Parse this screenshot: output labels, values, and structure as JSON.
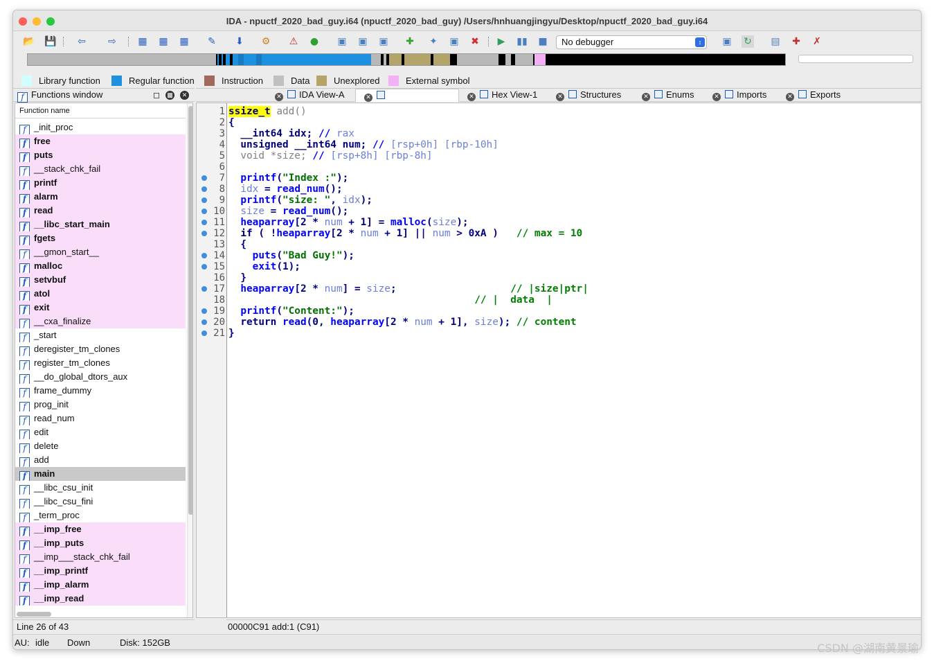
{
  "window": {
    "title": "IDA - npuctf_2020_bad_guy.i64 (npuctf_2020_bad_guy) /Users/hnhuangjingyu/Desktop/npuctf_2020_bad_guy.i64"
  },
  "toolbar": {
    "debugger_select": "No debugger"
  },
  "legend": [
    {
      "label": "Library function",
      "color": "#cfffff"
    },
    {
      "label": "Regular function",
      "color": "#1e90e0"
    },
    {
      "label": "Instruction",
      "color": "#a0695a"
    },
    {
      "label": "Data",
      "color": "#c0c0c0"
    },
    {
      "label": "Unexplored",
      "color": "#b5a46a"
    },
    {
      "label": "External symbol",
      "color": "#f4b0f4"
    }
  ],
  "functions_window": {
    "title": "Functions window",
    "column_header": "Function name",
    "items": [
      {
        "name": "_init_proc",
        "kind": "regular"
      },
      {
        "name": "free",
        "kind": "lib"
      },
      {
        "name": "puts",
        "kind": "lib"
      },
      {
        "name": "__stack_chk_fail",
        "kind": "lib-light"
      },
      {
        "name": "printf",
        "kind": "lib"
      },
      {
        "name": "alarm",
        "kind": "lib"
      },
      {
        "name": "read",
        "kind": "lib"
      },
      {
        "name": "__libc_start_main",
        "kind": "lib"
      },
      {
        "name": "fgets",
        "kind": "lib"
      },
      {
        "name": "__gmon_start__",
        "kind": "lib-light"
      },
      {
        "name": "malloc",
        "kind": "lib"
      },
      {
        "name": "setvbuf",
        "kind": "lib"
      },
      {
        "name": "atol",
        "kind": "lib"
      },
      {
        "name": "exit",
        "kind": "lib"
      },
      {
        "name": "__cxa_finalize",
        "kind": "lib-light"
      },
      {
        "name": "_start",
        "kind": "regular"
      },
      {
        "name": "deregister_tm_clones",
        "kind": "regular"
      },
      {
        "name": "register_tm_clones",
        "kind": "regular"
      },
      {
        "name": "__do_global_dtors_aux",
        "kind": "regular"
      },
      {
        "name": "frame_dummy",
        "kind": "regular"
      },
      {
        "name": "prog_init",
        "kind": "regular"
      },
      {
        "name": "read_num",
        "kind": "regular"
      },
      {
        "name": "edit",
        "kind": "regular"
      },
      {
        "name": "delete",
        "kind": "regular"
      },
      {
        "name": "add",
        "kind": "regular"
      },
      {
        "name": "main",
        "kind": "selected"
      },
      {
        "name": "__libc_csu_init",
        "kind": "regular"
      },
      {
        "name": "__libc_csu_fini",
        "kind": "regular"
      },
      {
        "name": "_term_proc",
        "kind": "regular"
      },
      {
        "name": "__imp_free",
        "kind": "lib"
      },
      {
        "name": "__imp_puts",
        "kind": "lib"
      },
      {
        "name": "__imp___stack_chk_fail",
        "kind": "lib-light"
      },
      {
        "name": "__imp_printf",
        "kind": "lib"
      },
      {
        "name": "__imp_alarm",
        "kind": "lib"
      },
      {
        "name": "__imp_read",
        "kind": "lib"
      }
    ],
    "line_status": "Line 26 of 43"
  },
  "tabs": [
    {
      "label": "IDA View-A"
    },
    {
      "label": ""
    },
    {
      "label": "Hex View-1"
    },
    {
      "label": "Structures"
    },
    {
      "label": "Enums"
    },
    {
      "label": "Imports"
    },
    {
      "label": "Exports"
    }
  ],
  "pseudocode": {
    "address_line": "00000C91 add:1 (C91)",
    "lines": [
      {
        "n": "1",
        "dot": false,
        "html": "<span class=\"hl\">ssize_t</span> <span class=\"g\">add()</span>"
      },
      {
        "n": "2",
        "dot": false,
        "html": "{"
      },
      {
        "n": "3",
        "dot": false,
        "html": "  __int64 idx; <span class=\"b\">//</span> <span class=\"lb\">rax</span>"
      },
      {
        "n": "4",
        "dot": false,
        "html": "  unsigned __int64 num; <span class=\"b\">//</span> <span class=\"lb\">[rsp+0h] [rbp-10h]</span>"
      },
      {
        "n": "5",
        "dot": false,
        "html": "  <span class=\"g\">void *size;</span> <span class=\"b\">//</span> <span class=\"lb\">[rsp+8h] [rbp-8h]</span>"
      },
      {
        "n": "6",
        "dot": false,
        "html": ""
      },
      {
        "n": "7",
        "dot": true,
        "html": "  <span class=\"b\">printf</span>(<span class=\"str\">\"Index :\"</span>);"
      },
      {
        "n": "8",
        "dot": true,
        "html": "  <span class=\"lb\">idx</span> = <span class=\"b\">read_num</span>();"
      },
      {
        "n": "9",
        "dot": true,
        "html": "  <span class=\"b\">printf</span>(<span class=\"str\">\"size: \"</span>, <span class=\"lb\">idx</span>);"
      },
      {
        "n": "10",
        "dot": true,
        "html": "  <span class=\"lb\">size</span> = <span class=\"b\">read_num</span>();"
      },
      {
        "n": "11",
        "dot": true,
        "html": "  <span class=\"b\">heaparray</span>[2 * <span class=\"lb\">num</span> + 1] = <span class=\"b\">malloc</span>(<span class=\"lb\">size</span>);"
      },
      {
        "n": "12",
        "dot": true,
        "html": "  if ( !<span class=\"b\">heaparray</span>[2 * <span class=\"lb\">num</span> + 1] || <span class=\"lb\">num</span> > 0xA )   <span class=\"cm\">// max = 10</span>"
      },
      {
        "n": "13",
        "dot": false,
        "html": "  {"
      },
      {
        "n": "14",
        "dot": true,
        "html": "    <span class=\"b\">puts</span>(<span class=\"str\">\"Bad Guy!\"</span>);"
      },
      {
        "n": "15",
        "dot": true,
        "html": "    <span class=\"b\">exit</span>(1);"
      },
      {
        "n": "16",
        "dot": false,
        "html": "  }"
      },
      {
        "n": "17",
        "dot": true,
        "html": "  <span class=\"b\">heaparray</span>[2 * <span class=\"lb\">num</span>] = <span class=\"lb\">size</span>;                   <span class=\"cm\">// |size|ptr|</span>"
      },
      {
        "n": "18",
        "dot": false,
        "html": "                                         <span class=\"cm\">// |  data  |</span>"
      },
      {
        "n": "19",
        "dot": true,
        "html": "  <span class=\"b\">printf</span>(<span class=\"str\">\"Content:\"</span>);"
      },
      {
        "n": "20",
        "dot": true,
        "html": "  return <span class=\"b\">read</span>(0, <span class=\"b\">heaparray</span>[2 * <span class=\"lb\">num</span> + 1], <span class=\"lb\">size</span>); <span class=\"cm\">// content</span>"
      },
      {
        "n": "21",
        "dot": true,
        "html": "}"
      }
    ]
  },
  "statusbar": {
    "au": "AU:",
    "au_state": "idle",
    "direction": "Down",
    "disk": "Disk: 152GB"
  },
  "watermark": "CSDN @湖南黄景瑜"
}
